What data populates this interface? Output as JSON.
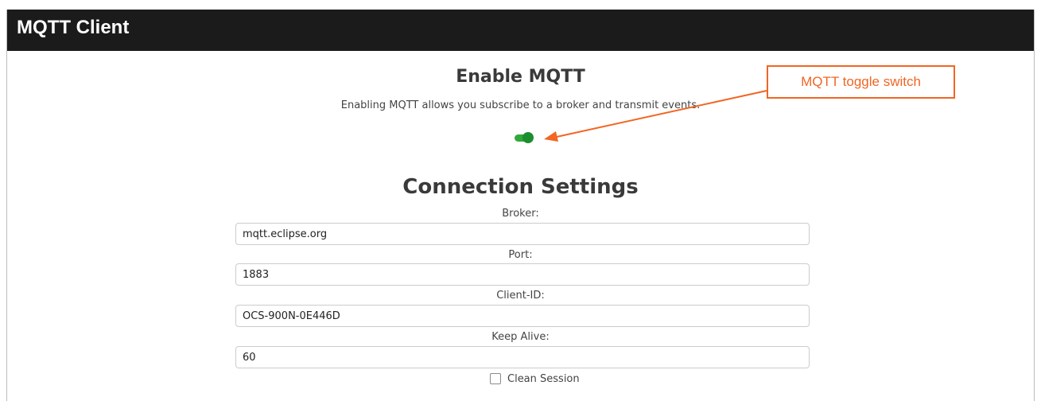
{
  "window": {
    "title": "MQTT Client"
  },
  "enable_section": {
    "heading": "Enable MQTT",
    "description": "Enabling MQTT allows you subscribe to a broker and transmit events.",
    "toggle_on": true
  },
  "connection": {
    "heading": "Connection Settings",
    "broker": {
      "label": "Broker:",
      "value": "mqtt.eclipse.org"
    },
    "port": {
      "label": "Port:",
      "value": "1883"
    },
    "client_id": {
      "label": "Client-ID:",
      "value": "OCS-900N-0E446D"
    },
    "keep_alive": {
      "label": "Keep Alive:",
      "value": "60"
    },
    "clean_session": {
      "label": "Clean Session",
      "checked": false
    }
  },
  "annotation": {
    "text": "MQTT toggle switch",
    "color": "#f26522"
  },
  "colors": {
    "titlebar": "#1b1b1b",
    "toggle_track": "#33a83a",
    "toggle_knob": "#1b8f2d"
  }
}
